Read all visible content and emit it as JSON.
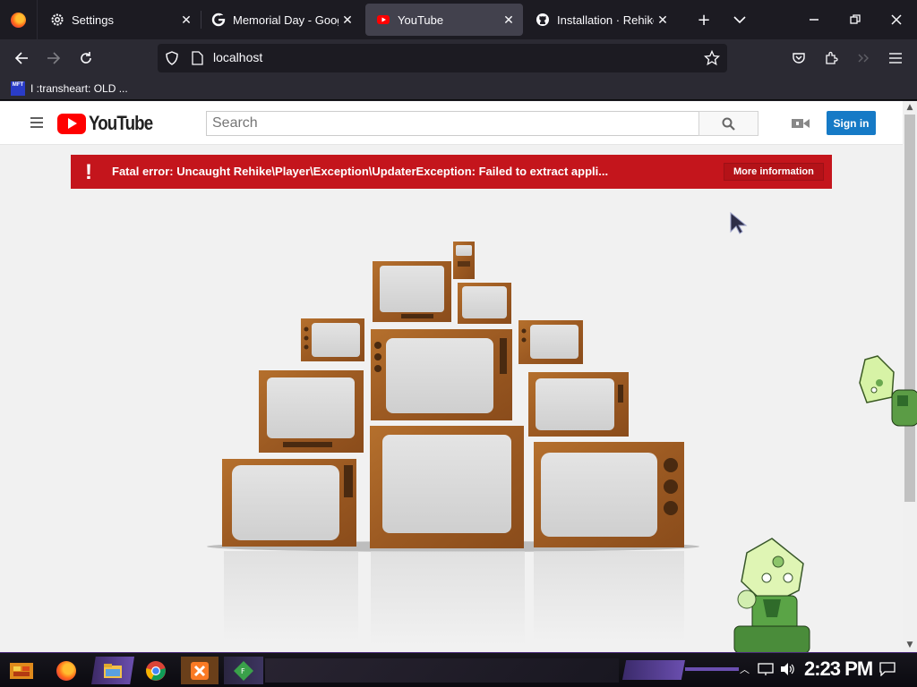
{
  "browser": {
    "tabs": [
      {
        "label": "Settings",
        "icon": "gear-icon",
        "active": false
      },
      {
        "label": "Memorial Day - Google",
        "icon": "google-icon",
        "active": false
      },
      {
        "label": "YouTube",
        "icon": "youtube-icon",
        "active": true
      },
      {
        "label": "Installation · Rehike/R",
        "icon": "github-icon",
        "active": false
      }
    ],
    "url": "localhost",
    "bookmarks": [
      {
        "label": "I :transheart: OLD ...",
        "icon_text": "MFT"
      }
    ]
  },
  "youtube": {
    "logo_text": "YouTube",
    "search_placeholder": "Search",
    "signin_label": "Sign in",
    "error": {
      "icon": "!",
      "message": "Fatal error: Uncaught Rehike\\Player\\Exception\\UpdaterException: Failed to extract appli...",
      "button_label": "More information"
    }
  },
  "taskbar": {
    "clock": "2:23 PM",
    "pinned": [
      "start-icon",
      "firefox-icon",
      "file-explorer-icon",
      "chrome-icon",
      "xampp-icon",
      "app-icon"
    ]
  },
  "colors": {
    "error_red": "#c4151c",
    "signin_blue": "#167ac6",
    "youtube_red": "#ff0000"
  }
}
